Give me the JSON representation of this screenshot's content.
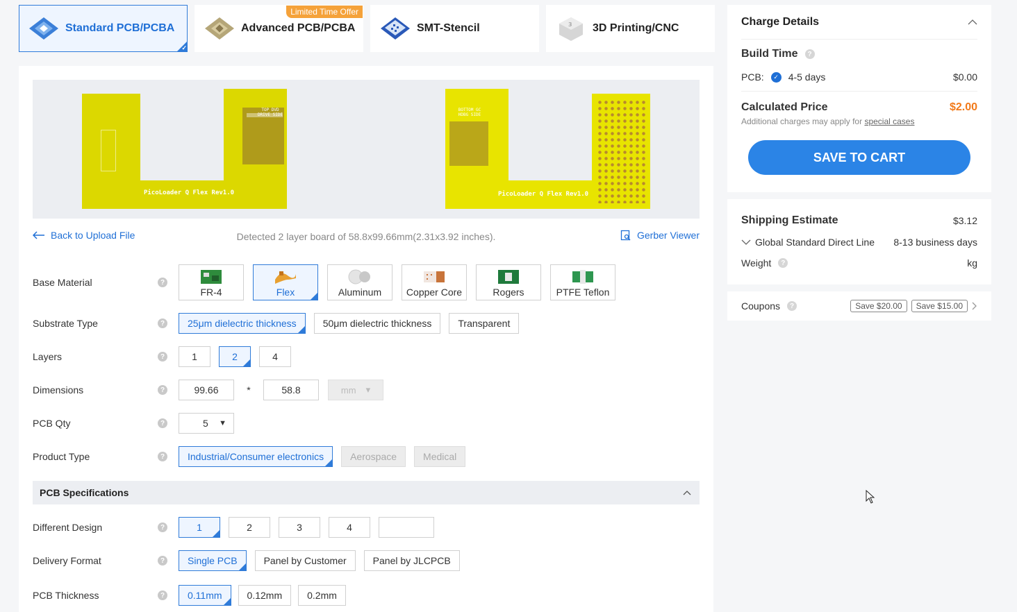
{
  "tabs": [
    {
      "label": "Standard PCB/PCBA",
      "active": true
    },
    {
      "label": "Advanced PCB/PCBA",
      "badge": "Limited Time Offer"
    },
    {
      "label": "SMT-Stencil"
    },
    {
      "label": "3D Printing/CNC"
    }
  ],
  "preview": {
    "left_board": {
      "title": "PicoLoader Q Flex Rev1.0",
      "side": "TOP DVD DRIVE SIDE"
    },
    "right_board": {
      "title": "PicoLoader Q Flex Rev1.0",
      "side": "BOTTOM GC HDBG SIDE"
    }
  },
  "actions": {
    "back": "Back to Upload File",
    "detected": "Detected 2 layer board of 58.8x99.66mm(2.31x3.92 inches).",
    "gerber": "Gerber Viewer"
  },
  "form": {
    "base_material": {
      "label": "Base Material",
      "options": [
        "FR-4",
        "Flex",
        "Aluminum",
        "Copper Core",
        "Rogers",
        "PTFE Teflon"
      ],
      "selected": "Flex"
    },
    "substrate": {
      "label": "Substrate Type",
      "options": [
        "25μm dielectric thickness",
        "50μm dielectric thickness",
        "Transparent"
      ],
      "selected": "25μm dielectric thickness"
    },
    "layers": {
      "label": "Layers",
      "options": [
        "1",
        "2",
        "4"
      ],
      "selected": "2"
    },
    "dimensions": {
      "label": "Dimensions",
      "length": "99.66",
      "sep": "*",
      "width": "58.8",
      "unit": "mm"
    },
    "qty": {
      "label": "PCB Qty",
      "value": "5"
    },
    "product_type": {
      "label": "Product Type",
      "options": [
        "Industrial/Consumer electronics",
        "Aerospace",
        "Medical"
      ],
      "selected": "Industrial/Consumer electronics"
    },
    "spec_title": "PCB Specifications",
    "different_design": {
      "label": "Different Design",
      "options": [
        "1",
        "2",
        "3",
        "4",
        ""
      ],
      "selected": "1"
    },
    "delivery": {
      "label": "Delivery Format",
      "options": [
        "Single PCB",
        "Panel by Customer",
        "Panel by JLCPCB"
      ],
      "selected": "Single PCB"
    },
    "thickness": {
      "label": "PCB Thickness",
      "options": [
        "0.11mm",
        "0.12mm",
        "0.2mm"
      ],
      "selected": "0.11mm"
    }
  },
  "charge": {
    "title": "Charge Details",
    "build_time": "Build Time",
    "pcb_label": "PCB:",
    "pcb_days": "4-5 days",
    "pcb_price": "$0.00",
    "calc_label": "Calculated Price",
    "calc_price": "$2.00",
    "note_prefix": "Additional charges may apply for",
    "note_link": "special cases",
    "cart": "SAVE TO CART"
  },
  "shipping": {
    "title": "Shipping Estimate",
    "price": "$3.12",
    "method": "Global Standard Direct Line",
    "days": "8-13 business days",
    "weight_label": "Weight",
    "weight_unit": "kg"
  },
  "coupons": {
    "label": "Coupons",
    "tags": [
      "Save $20.00",
      "Save $15.00"
    ]
  },
  "colors": {
    "accent": "#2f7bd9",
    "price": "#f27a1a",
    "board": "#e3e000"
  }
}
